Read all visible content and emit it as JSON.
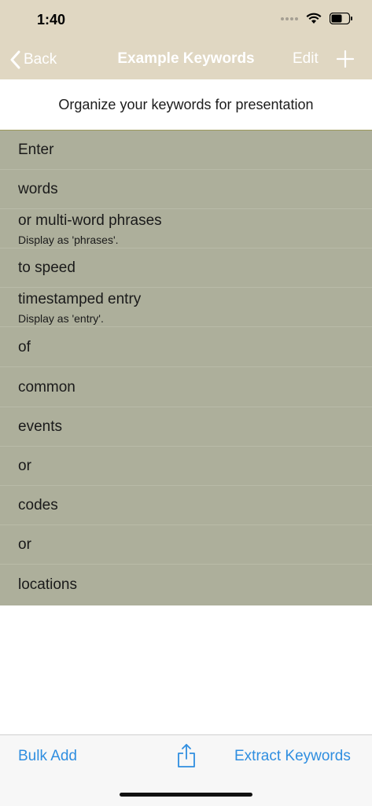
{
  "status": {
    "time": "1:40"
  },
  "nav": {
    "back_label": "Back",
    "title": "Example Keywords",
    "edit_label": "Edit"
  },
  "subheader": "Organize your keywords for presentation",
  "keywords": [
    {
      "label": "Enter",
      "display": ""
    },
    {
      "label": "words",
      "display": ""
    },
    {
      "label": "or multi-word phrases",
      "display": "Display as 'phrases'."
    },
    {
      "label": "to speed",
      "display": ""
    },
    {
      "label": "timestamped entry",
      "display": "Display as 'entry'."
    },
    {
      "label": "of",
      "display": ""
    },
    {
      "label": "common",
      "display": ""
    },
    {
      "label": "events",
      "display": ""
    },
    {
      "label": "or",
      "display": ""
    },
    {
      "label": "codes",
      "display": ""
    },
    {
      "label": "or",
      "display": ""
    },
    {
      "label": "locations",
      "display": ""
    }
  ],
  "toolbar": {
    "bulk_add_label": "Bulk Add",
    "extract_label": "Extract Keywords"
  },
  "colors": {
    "nav_background": "#e0d7c2",
    "list_background": "#adaf9b",
    "accent_blue": "#2f8ee0"
  },
  "icons": [
    "back-chevron-icon",
    "plus-icon",
    "share-icon",
    "wifi-icon",
    "battery-icon",
    "signal-icon"
  ]
}
